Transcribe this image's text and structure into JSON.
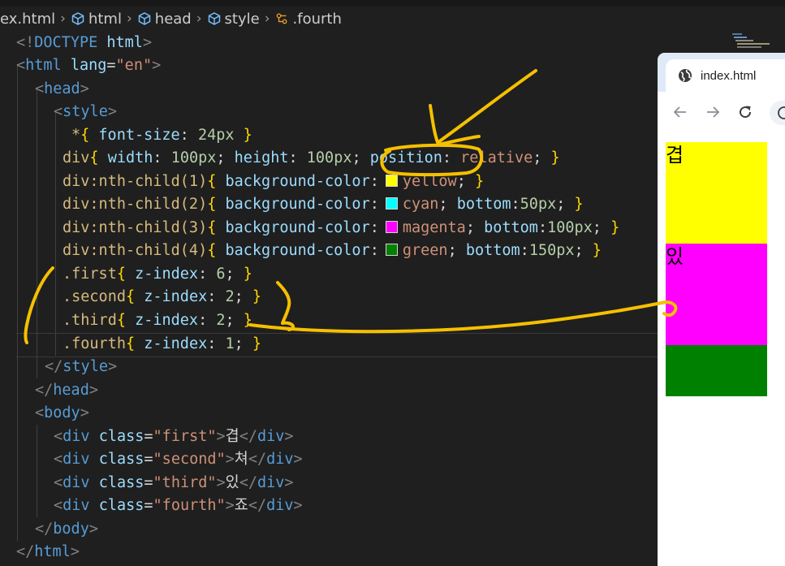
{
  "breadcrumb": {
    "file": "ex.html",
    "items": [
      "html",
      "head",
      "style",
      ".fourth"
    ]
  },
  "code": {
    "l1": {
      "open": "<!",
      "kw": "DOCTYPE",
      "sp": " ",
      "name": "html",
      "close": ">"
    },
    "l2": {
      "open": "<",
      "tag": "html",
      "attr": "lang",
      "eq": "=",
      "val": "\"en\"",
      "close": ">"
    },
    "l3": {
      "open": "<",
      "tag": "head",
      "close": ">"
    },
    "l4": {
      "open": "<",
      "tag": "style",
      "close": ">"
    },
    "l5": {
      "sel": "*",
      "ob": "{",
      "prop": "font-size",
      "colon": ": ",
      "num": "24px",
      "cb": "}"
    },
    "l6": {
      "sel": "div",
      "ob": "{",
      "p1": "width",
      "v1": "100px",
      "p2": "height",
      "v2": "100px",
      "p3": "position",
      "v3": "relative",
      "cb": "}"
    },
    "l7": {
      "sel": "div:nth-child(1)",
      "ob": "{",
      "prop": "background-color",
      "val": "yellow",
      "cb": "}"
    },
    "l8": {
      "sel": "div:nth-child(2)",
      "ob": "{",
      "prop": "background-color",
      "val": "cyan",
      "p2": "bottom",
      "v2": "50px",
      "cb": "}"
    },
    "l9": {
      "sel": "div:nth-child(3)",
      "ob": "{",
      "prop": "background-color",
      "val": "magenta",
      "p2": "bottom",
      "v2": "100px",
      "cb": "}"
    },
    "l10": {
      "sel": "div:nth-child(4)",
      "ob": "{",
      "prop": "background-color",
      "val": "green",
      "p2": "bottom",
      "v2": "150px",
      "cb": "}"
    },
    "l11": {
      "sel": ".first",
      "ob": "{",
      "prop": "z-index",
      "num": "6",
      "cb": "}"
    },
    "l12": {
      "sel": ".second",
      "ob": "{",
      "prop": "z-index",
      "num": "2",
      "cb": "}"
    },
    "l13": {
      "sel": ".third",
      "ob": "{",
      "prop": "z-index",
      "num": "2",
      "cb": "}"
    },
    "l14": {
      "sel": ".fourth",
      "ob": "{",
      "prop": "z-index",
      "num": "1",
      "cb": "}"
    },
    "l15": {
      "open": "</",
      "tag": "style",
      "close": ">"
    },
    "l16": {
      "open": "</",
      "tag": "head",
      "close": ">"
    },
    "l17": {
      "open": "<",
      "tag": "body",
      "close": ">"
    },
    "l18": {
      "tag": "div",
      "attr": "class",
      "val": "\"first\"",
      "text": "겹"
    },
    "l19": {
      "tag": "div",
      "attr": "class",
      "val": "\"second\"",
      "text": "쳐"
    },
    "l20": {
      "tag": "div",
      "attr": "class",
      "val": "\"third\"",
      "text": "있"
    },
    "l21": {
      "tag": "div",
      "attr": "class",
      "val": "\"fourth\"",
      "text": "죠"
    },
    "l22": {
      "open": "</",
      "tag": "body",
      "close": ">"
    },
    "l23": {
      "open": "</",
      "tag": "html",
      "close": ">"
    }
  },
  "swatches": {
    "yellow": "#ffff00",
    "cyan": "#00ffff",
    "magenta": "#ff00ff",
    "green": "#008000"
  },
  "browser": {
    "tab_title": "index.html",
    "boxes": [
      {
        "text": "겹",
        "color": "#ffff00"
      },
      {
        "text": "있",
        "color": "#ff00ff"
      },
      {
        "text": "",
        "color": "#008000"
      }
    ]
  },
  "annotation_color": "#f5c000"
}
